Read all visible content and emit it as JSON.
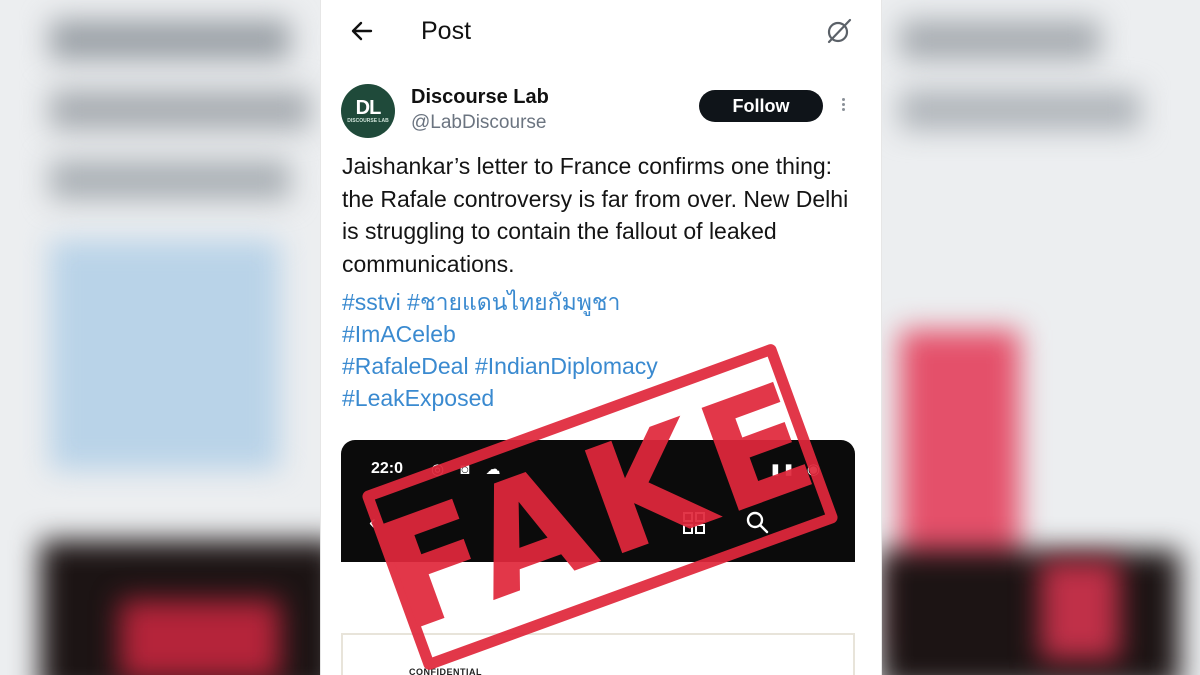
{
  "header": {
    "title": "Post"
  },
  "author": {
    "avatar_monogram": "DL",
    "avatar_subtext": "DISCOURSE LAB",
    "display_name": "Discourse Lab",
    "handle": "@LabDiscourse",
    "follow_label": "Follow"
  },
  "tweet": {
    "text": "Jaishankar’s letter to France confirms one thing: the Rafale controversy is far from over. New Delhi is struggling to contain the fallout of leaked communications.",
    "hashtags": [
      "#sstvi #ชายแดนไทยกัมพูชา",
      "#ImACeleb",
      "#RafaleDeal #IndianDiplomacy",
      "#LeakExposed"
    ]
  },
  "media": {
    "status_time": "22:0",
    "document_label": "CONFIDENTIAL"
  },
  "stamp": {
    "text": "FAKE",
    "color": "#e0283c"
  },
  "colors": {
    "hashtag": "#3a8ad0",
    "follow_bg": "#0f1419"
  },
  "icons": [
    "back-arrow-icon",
    "grok-icon",
    "more-icon",
    "grid-icon",
    "search-icon"
  ]
}
